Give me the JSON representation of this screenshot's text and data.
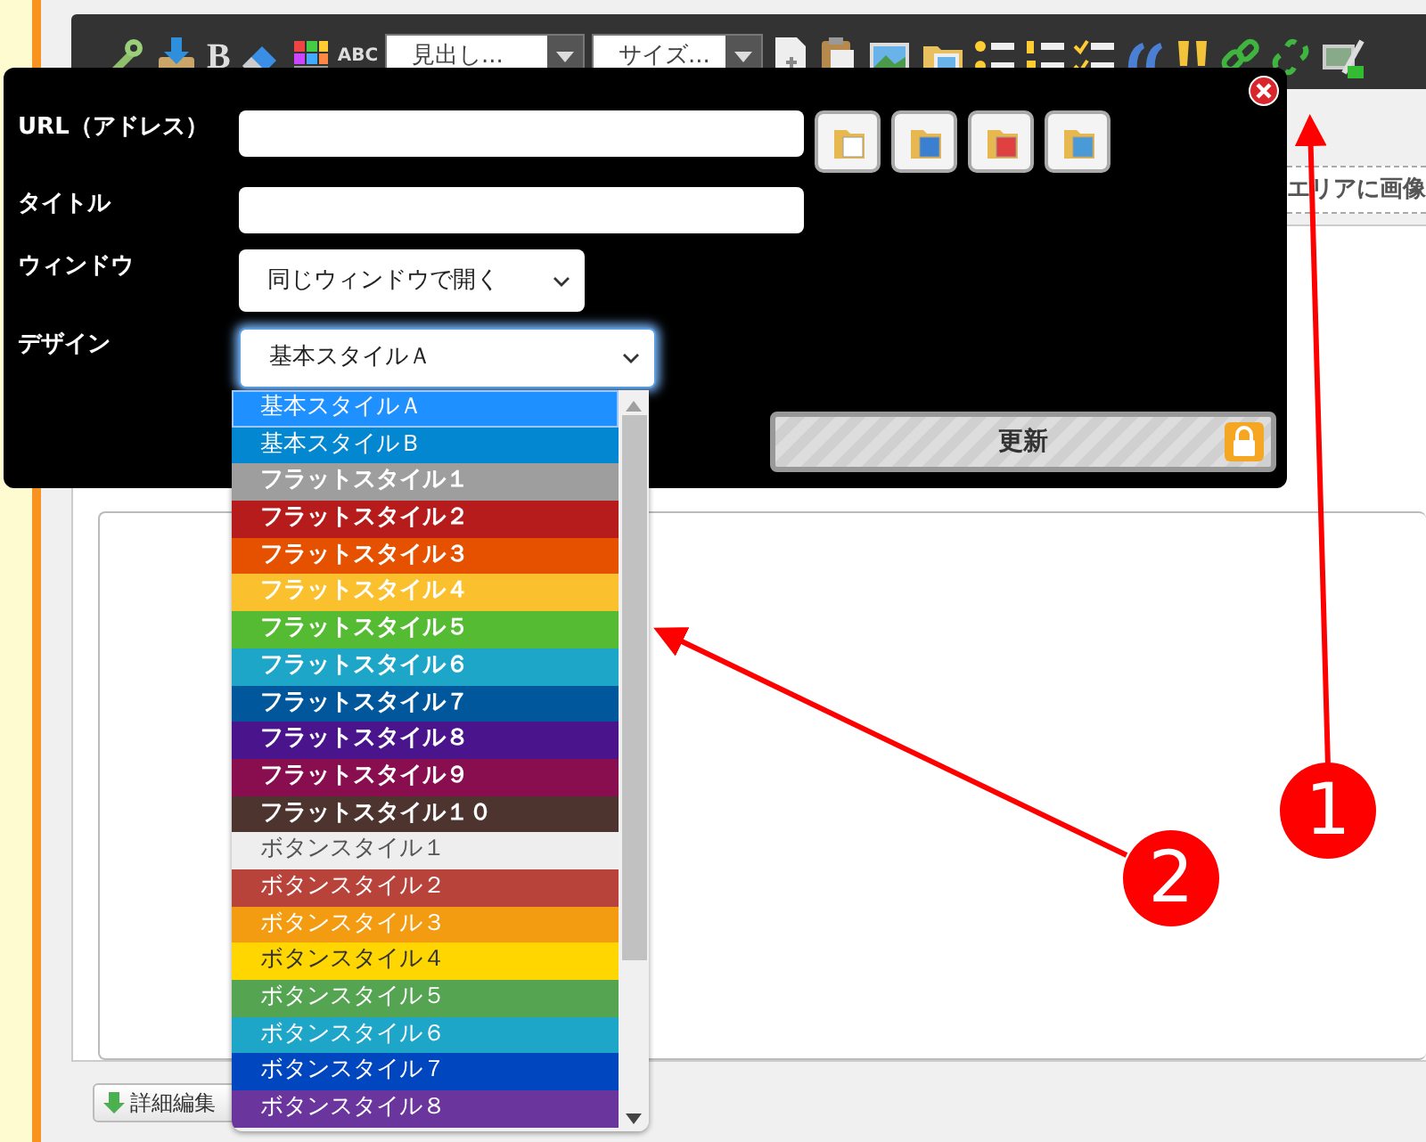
{
  "toolbar": {
    "bold": "B",
    "spellcheck": "ABC",
    "heading_select": "見出し...",
    "size_select": "サイズ..."
  },
  "editor": {
    "drop_hint": "エリアに画像",
    "detail_button": "詳細編集"
  },
  "dialog": {
    "url_label": "URL（アドレス）",
    "title_label": "タイトル",
    "window_label": "ウィンドウ",
    "window_value": "同じウィンドウで開く",
    "design_label": "デザイン",
    "design_value": "基本スタイルＡ",
    "update_button": "更新"
  },
  "design_options": [
    {
      "label": "基本スタイルＡ",
      "kind": "basic",
      "color": "#1e90ff",
      "selected": true
    },
    {
      "label": "基本スタイルＢ",
      "kind": "basic",
      "color": "#0487d1",
      "selected": false
    },
    {
      "label": "フラットスタイル１",
      "kind": "flat",
      "color": "#9e9e9e",
      "selected": false
    },
    {
      "label": "フラットスタイル２",
      "kind": "flat",
      "color": "#b71c1c",
      "selected": false
    },
    {
      "label": "フラットスタイル３",
      "kind": "flat",
      "color": "#e65100",
      "selected": false
    },
    {
      "label": "フラットスタイル４",
      "kind": "flat",
      "color": "#fbc02d",
      "selected": false
    },
    {
      "label": "フラットスタイル５",
      "kind": "flat",
      "color": "#55bb33",
      "selected": false
    },
    {
      "label": "フラットスタイル６",
      "kind": "flat",
      "color": "#1ea6c8",
      "selected": false
    },
    {
      "label": "フラットスタイル７",
      "kind": "flat",
      "color": "#01579b",
      "selected": false
    },
    {
      "label": "フラットスタイル８",
      "kind": "flat",
      "color": "#4a148c",
      "selected": false
    },
    {
      "label": "フラットスタイル９",
      "kind": "flat",
      "color": "#880e4f",
      "selected": false
    },
    {
      "label": "フラットスタイル１０",
      "kind": "flat",
      "color": "#4e342e",
      "selected": false
    },
    {
      "label": "ボタンスタイル１",
      "kind": "button",
      "color": "#eeeeee",
      "selected": false
    },
    {
      "label": "ボタンスタイル２",
      "kind": "button",
      "color": "#b8433b",
      "selected": false
    },
    {
      "label": "ボタンスタイル３",
      "kind": "button",
      "color": "#f39c12",
      "selected": false
    },
    {
      "label": "ボタンスタイル４",
      "kind": "button",
      "color": "#ffd600",
      "selected": false
    },
    {
      "label": "ボタンスタイル５",
      "kind": "button",
      "color": "#55a452",
      "selected": false
    },
    {
      "label": "ボタンスタイル６",
      "kind": "button",
      "color": "#1ea6c8",
      "selected": false
    },
    {
      "label": "ボタンスタイル７",
      "kind": "button",
      "color": "#0046be",
      "selected": false
    },
    {
      "label": "ボタンスタイル８",
      "kind": "button",
      "color": "#6a359c",
      "selected": false
    }
  ],
  "callouts": [
    {
      "number": "1"
    },
    {
      "number": "2"
    }
  ]
}
